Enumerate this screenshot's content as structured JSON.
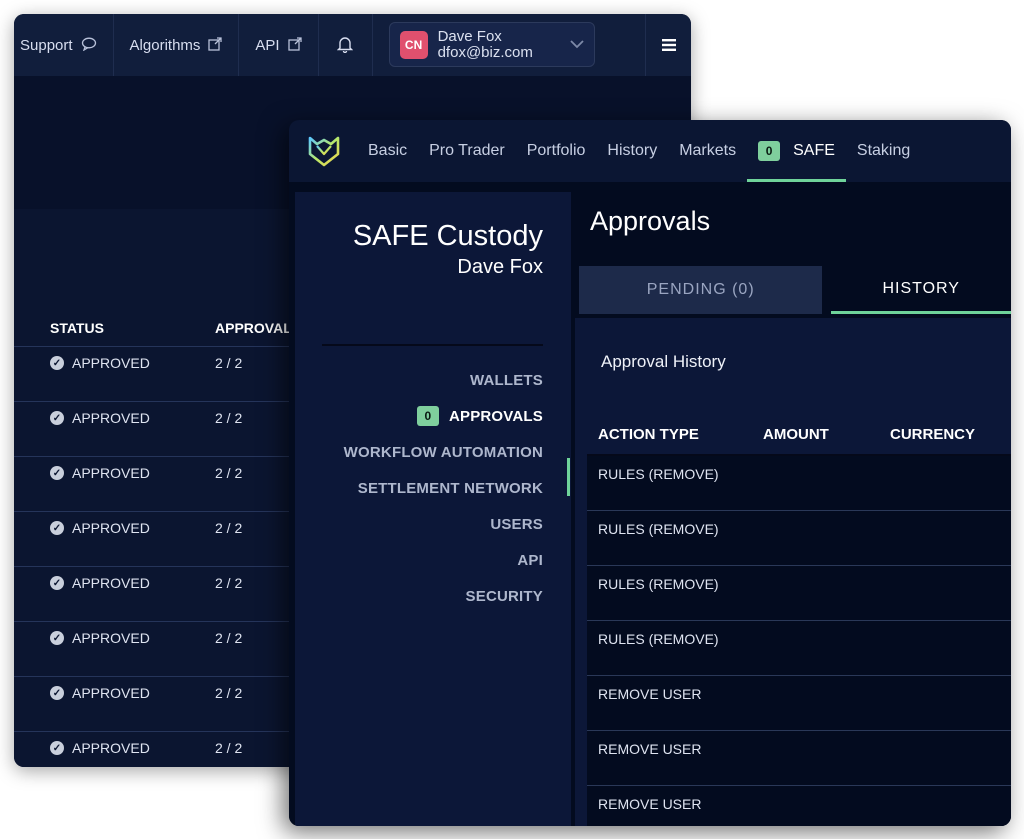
{
  "back_window": {
    "nav": {
      "support": "Support",
      "algorithms": "Algorithms",
      "api": "API"
    },
    "user": {
      "initials": "CN",
      "name": "Dave Fox",
      "email": "dfox@biz.com"
    },
    "table": {
      "headers": [
        "STATUS",
        "APPROVAL"
      ],
      "rows": [
        {
          "status": "APPROVED",
          "approvals": "2 / 2"
        },
        {
          "status": "APPROVED",
          "approvals": "2 / 2"
        },
        {
          "status": "APPROVED",
          "approvals": "2 / 2"
        },
        {
          "status": "APPROVED",
          "approvals": "2 / 2"
        },
        {
          "status": "APPROVED",
          "approvals": "2 / 2"
        },
        {
          "status": "APPROVED",
          "approvals": "2 / 2"
        },
        {
          "status": "APPROVED",
          "approvals": "2 / 2"
        },
        {
          "status": "APPROVED",
          "approvals": "2 / 2"
        }
      ]
    }
  },
  "front_window": {
    "nav": [
      {
        "label": "Basic"
      },
      {
        "label": "Pro Trader"
      },
      {
        "label": "Portfolio"
      },
      {
        "label": "History"
      },
      {
        "label": "Markets"
      },
      {
        "label": "SAFE",
        "badge": "0",
        "active": true
      },
      {
        "label": "Staking"
      }
    ],
    "sidebar": {
      "title": "SAFE Custody",
      "subtitle": "Dave Fox",
      "items": [
        {
          "label": "WALLETS"
        },
        {
          "label": "APPROVALS",
          "badge": "0",
          "active": true
        },
        {
          "label": "WORKFLOW AUTOMATION"
        },
        {
          "label": "SETTLEMENT NETWORK"
        },
        {
          "label": "USERS"
        },
        {
          "label": "API"
        },
        {
          "label": "SECURITY"
        }
      ]
    },
    "main": {
      "title": "Approvals",
      "tabs": {
        "pending": "PENDING (0)",
        "history": "HISTORY"
      },
      "panel_title": "Approval History",
      "columns": [
        "ACTION TYPE",
        "AMOUNT",
        "CURRENCY"
      ],
      "rows": [
        {
          "action": "RULES (REMOVE)"
        },
        {
          "action": "RULES (REMOVE)"
        },
        {
          "action": "RULES (REMOVE)"
        },
        {
          "action": "RULES (REMOVE)"
        },
        {
          "action": "REMOVE USER"
        },
        {
          "action": "REMOVE USER"
        },
        {
          "action": "REMOVE USER"
        }
      ]
    }
  },
  "colors": {
    "accent": "#6fd39a",
    "badge": "#7fcf9d",
    "avatar": "#e0506e",
    "background_dark": "#030b1f",
    "panel": "#0c1738"
  }
}
